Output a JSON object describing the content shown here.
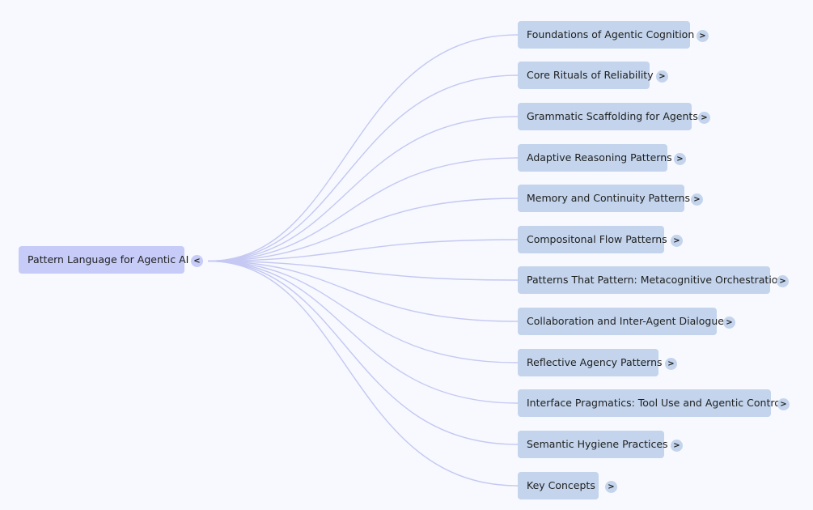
{
  "root": {
    "label": "Pattern Language for Agentic AI",
    "toggle": "<"
  },
  "children": [
    {
      "label": "Foundations of Agentic Cognition",
      "toggle": ">"
    },
    {
      "label": "Core Rituals of Reliability",
      "toggle": ">"
    },
    {
      "label": "Grammatic Scaffolding for Agents",
      "toggle": ">"
    },
    {
      "label": "Adaptive Reasoning Patterns",
      "toggle": ">"
    },
    {
      "label": "Memory and Continuity Patterns",
      "toggle": ">"
    },
    {
      "label": "Compositonal Flow Patterns",
      "toggle": ">"
    },
    {
      "label": "Patterns That Pattern: Metacognitive Orchestration",
      "toggle": ">"
    },
    {
      "label": "Collaboration and Inter-Agent Dialogue",
      "toggle": ">"
    },
    {
      "label": "Reflective Agency Patterns",
      "toggle": ">"
    },
    {
      "label": "Interface Pragmatics: Tool Use and Agentic Control",
      "toggle": ">"
    },
    {
      "label": "Semantic Hygiene Practices",
      "toggle": ">"
    },
    {
      "label": "Key Concepts",
      "toggle": ">"
    }
  ],
  "colors": {
    "background": "#f7f9fe",
    "root_node": "#c7cbf7",
    "child_node": "#c3d4ec",
    "edge": "#c5c8f2"
  }
}
